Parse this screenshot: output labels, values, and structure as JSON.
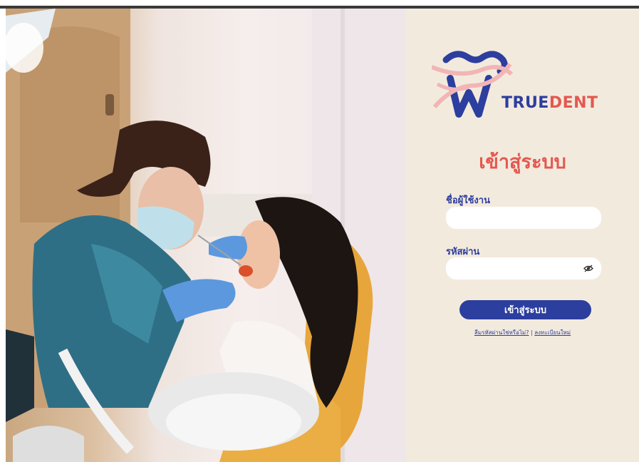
{
  "brand": {
    "name_part1": "TRUE",
    "name_part2": "DENT",
    "primary_color": "#2c3e9e",
    "accent_color": "#e4584f",
    "panel_color": "#f3eade"
  },
  "login": {
    "title": "เข้าสู่ระบบ",
    "username_label": "ชื่อผู้ใช้งาน",
    "username_value": "",
    "password_label": "รหัสผ่าน",
    "password_value": "",
    "password_toggle_icon": "eye-off-icon",
    "submit_label": "เข้าสู่ระบบ",
    "forgot_password_link": "ลืมรหัสผ่านใช่หรือไม่?",
    "separator": "|",
    "register_link": "ลงทะเบียนใหม่"
  },
  "photo": {
    "subject": "dentist-with-patient-photo"
  }
}
